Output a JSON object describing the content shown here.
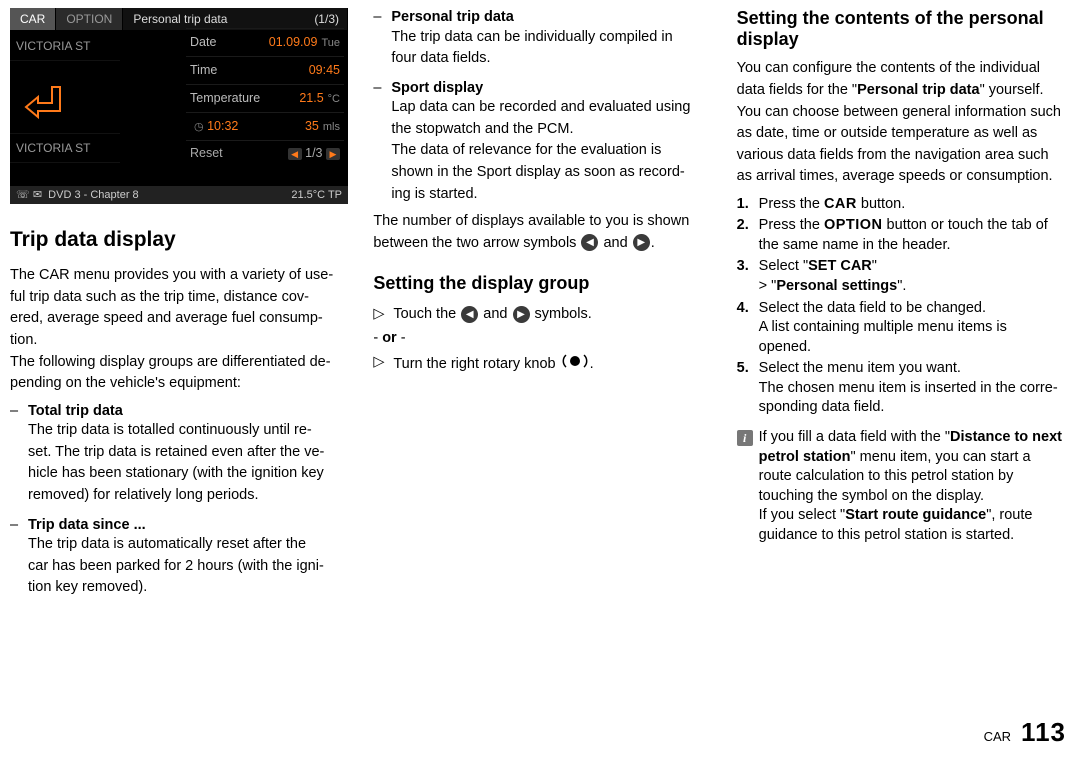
{
  "screenshot": {
    "tab_car": "CAR",
    "tab_option": "OPTION",
    "tab_title": "Personal trip data",
    "tab_count": "(1/3)",
    "stop1": "VICTORIA ST",
    "stop2": "VICTORIA ST",
    "row_date_label": "Date",
    "row_date_value": "01.09.09",
    "row_date_suffix": "Tue",
    "row_time_label": "Time",
    "row_time_value": "09:45",
    "row_temp_label": "Temperature",
    "row_temp_value": "21.5",
    "row_temp_unit": "°C",
    "row_dist_time": "10:32",
    "row_dist_val": "35",
    "row_dist_unit": "mls",
    "reset_label": "Reset",
    "reset_page": "1/3",
    "bottom_left": "DVD 3 - Chapter 8",
    "bottom_right": "21.5°C  TP"
  },
  "col1": {
    "h_trip": "Trip data display",
    "p1a": "The CAR menu provides you with a variety of use-",
    "p1b": "ful trip data such as the trip time, distance cov-",
    "p1c": "ered, average speed and average fuel consump-",
    "p1d": "tion.",
    "p2a": "The following display groups are differentiated de-",
    "p2b": "pending on the vehicle's equipment:",
    "i1_title": "Total trip data",
    "i1_l1": "The trip data is totalled continuously until re-",
    "i1_l2": "set. The trip data is retained even after the ve-",
    "i1_l3": "hicle has been stationary (with the ignition key",
    "i1_l4": "removed) for relatively long periods.",
    "i2_title": "Trip data since ...",
    "i2_l1": "The trip data is automatically reset after the",
    "i2_l2": "car has been parked for 2 hours (with the igni-",
    "i2_l3": "tion key removed)."
  },
  "col2": {
    "i3_title": "Personal trip data",
    "i3_l1": "The trip data can be individually compiled in",
    "i3_l2": "four data fields.",
    "i4_title": "Sport display",
    "i4_l1": "Lap data can be recorded and evaluated using",
    "i4_l2": "the stopwatch and the PCM.",
    "i4_l3": "The data of relevance for the evaluation is",
    "i4_l4": "shown in the Sport display as soon as record-",
    "i4_l5": "ing is started.",
    "p3a": "The number of displays available to you is shown",
    "p3b_pre": "between the two arrow symbols ",
    "p3b_mid": " and ",
    "p3b_post": ".",
    "h_set": "Setting the display group",
    "s1_pre": "Touch the ",
    "s1_mid": " and ",
    "s1_post": " symbols.",
    "or": "or",
    "s2_pre": "Turn the right rotary knob ",
    "s2_post": "."
  },
  "col3": {
    "h_set2a": "Setting the contents of the personal",
    "h_set2b": "display",
    "p4a": "You can configure the contents of the individual",
    "p4b_pre": "data fields for the \"",
    "p4b_bold": "Personal trip data",
    "p4b_post": "\" yourself.",
    "p4c": "You can choose between general information such",
    "p4d": "as date, time or outside temperature as well as",
    "p4e": "various data fields from the navigation area such",
    "p4f": "as arrival times, average speeds or consumption.",
    "n1_pre": "Press the ",
    "n1_caps": "CAR",
    "n1_post": " button.",
    "n2_pre": "Press the ",
    "n2_caps": "OPTION",
    "n2_post": " button or touch the tab of",
    "n2_l2": "the same name in the header.",
    "n3_pre": "Select \"",
    "n3_bold": "SET CAR",
    "n3_post": "\"",
    "n3_sub_pre": "> \"",
    "n3_sub_bold": "Personal settings",
    "n3_sub_post": "\".",
    "n4_l1": "Select the data field to be changed.",
    "n4_l2": "A list containing multiple menu items is",
    "n4_l3": "opened.",
    "n5_l1": "Select the menu item you want.",
    "n5_l2": "The chosen menu item is inserted in the corre-",
    "n5_l3": "sponding data field.",
    "info_l1_pre": "If you fill a data field with the \"",
    "info_l1_bold": "Distance to next",
    "info_l2_bold": "petrol station",
    "info_l2_post": "\" menu item, you can start a",
    "info_l3": "route calculation to this petrol station by",
    "info_l4": "touching the symbol on the display.",
    "info_l5_pre": "If you select \"",
    "info_l5_bold": "Start route guidance",
    "info_l5_post": "\", route",
    "info_l6": "guidance to this petrol station is started."
  },
  "footer": {
    "section": "CAR",
    "page": "113"
  }
}
